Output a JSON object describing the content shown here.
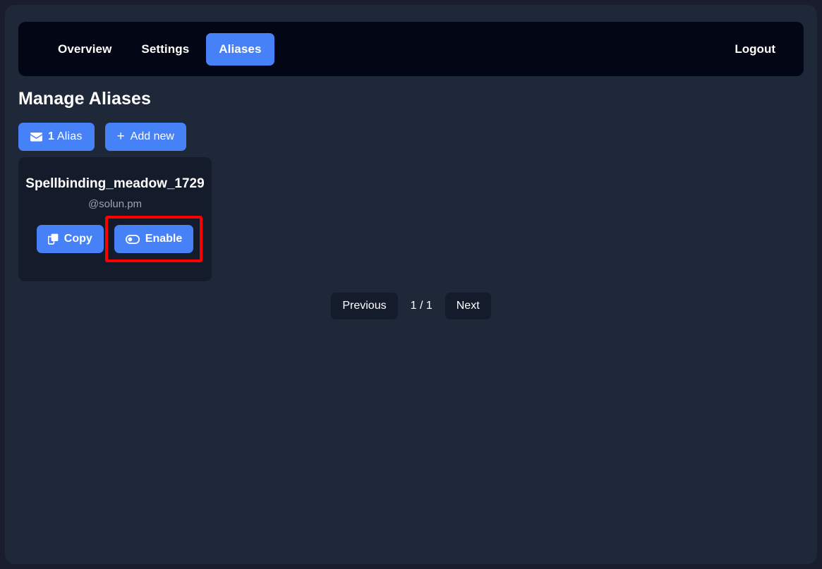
{
  "navbar": {
    "items": [
      {
        "label": "Overview",
        "active": false
      },
      {
        "label": "Settings",
        "active": false
      },
      {
        "label": "Aliases",
        "active": true
      }
    ],
    "logout_label": "Logout"
  },
  "page": {
    "title": "Manage Aliases"
  },
  "actions": {
    "alias_count": "1",
    "alias_count_label": " Alias",
    "alias_count_icon": "envelope-icon",
    "add_new_label": "Add new",
    "add_new_icon": "plus-icon"
  },
  "alias_card": {
    "name": "Spellbinding_meadow_1729",
    "domain": "@solun.pm",
    "copy_label": "Copy",
    "copy_icon": "copy-icon",
    "enable_label": "Enable",
    "enable_icon": "toggle-off-icon",
    "highlighted_control": "enable-button"
  },
  "pagination": {
    "previous_label": "Previous",
    "indicator": "1 / 1",
    "next_label": "Next"
  },
  "colors": {
    "accent": "#4781f8",
    "navbar_bg": "#030715",
    "container_bg": "#1f2839",
    "page_bg": "#191d2d",
    "card_bg": "#141b2b",
    "muted_text": "#9aa4b4",
    "highlight_outline": "#fe0000"
  }
}
